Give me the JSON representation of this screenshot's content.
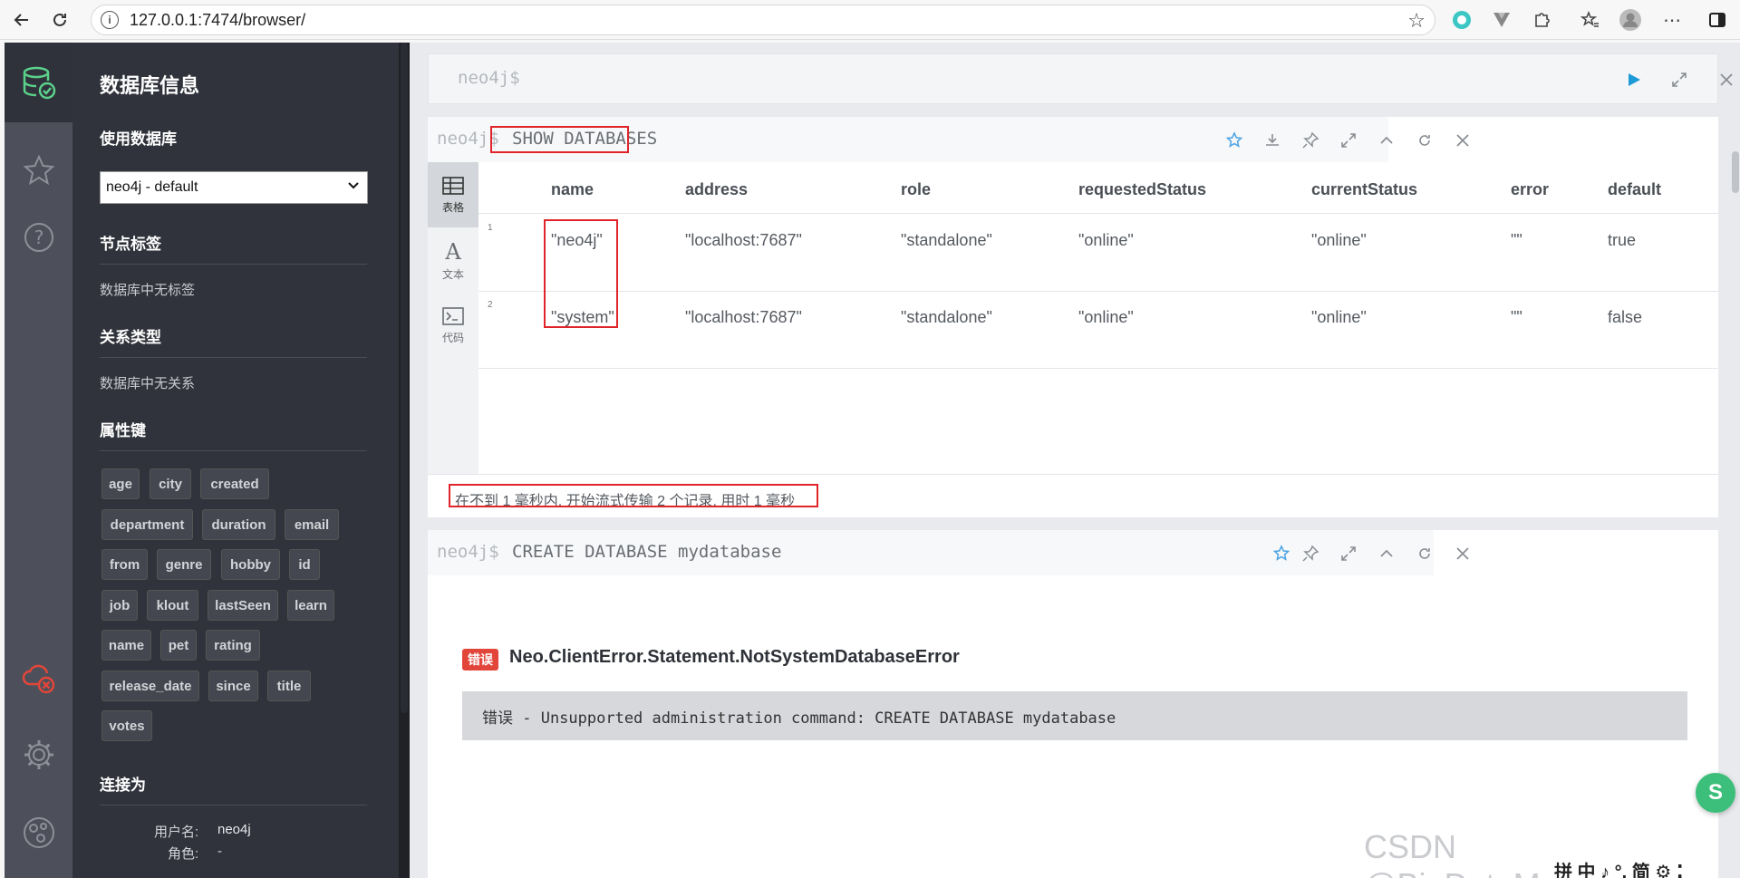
{
  "browser": {
    "url": "127.0.0.1:7474/browser/"
  },
  "drawer": {
    "title": "数据库信息",
    "use_db_heading": "使用数据库",
    "db_select_value": "neo4j - default",
    "node_labels_heading": "节点标签",
    "node_labels_empty": "数据库中无标签",
    "rel_types_heading": "关系类型",
    "rel_types_empty": "数据库中无关系",
    "property_keys_heading": "属性键",
    "property_keys": [
      "age",
      "city",
      "created",
      "department",
      "duration",
      "email",
      "from",
      "genre",
      "hobby",
      "id",
      "job",
      "klout",
      "lastSeen",
      "learn",
      "name",
      "pet",
      "rating",
      "release_date",
      "since",
      "title",
      "votes"
    ],
    "connected_as_heading": "连接为",
    "username_label": "用户名:",
    "username_value": "neo4j",
    "role_label": "角色:",
    "role_value": "-"
  },
  "editor": {
    "prompt": "neo4j$"
  },
  "frame1": {
    "prompt": "neo4j$",
    "command": "SHOW DATABASES",
    "tabs": [
      {
        "label": "表格",
        "icon": "table-icon"
      },
      {
        "label": "文本",
        "icon": "text-icon"
      },
      {
        "label": "代码",
        "icon": "code-icon"
      }
    ],
    "columns": [
      "name",
      "address",
      "role",
      "requestedStatus",
      "currentStatus",
      "error",
      "default"
    ],
    "rows": [
      {
        "num": "1",
        "cells": [
          "\"neo4j\"",
          "\"localhost:7687\"",
          "\"standalone\"",
          "\"online\"",
          "\"online\"",
          "\"\"",
          "true"
        ]
      },
      {
        "num": "2",
        "cells": [
          "\"system\"",
          "\"localhost:7687\"",
          "\"standalone\"",
          "\"online\"",
          "\"online\"",
          "\"\"",
          "false"
        ]
      }
    ],
    "status": "在不到 1 毫秒内, 开始流式传输 2 个记录, 用时 1 毫秒"
  },
  "frame2": {
    "prompt": "neo4j$",
    "command": "CREATE DATABASE mydatabase",
    "error_badge": "错误",
    "error_title": "Neo.ClientError.Statement.NotSystemDatabaseError",
    "error_message": "错误 - Unsupported administration command: CREATE DATABASE mydatabase"
  },
  "overlay": {
    "watermark": "CSDN @BigDataMagician",
    "ime": "拼 中 ♪ °, 简 ⚙ ⁚"
  },
  "colors": {
    "rail": "#4d505a",
    "drawer": "#30333b",
    "accent_green": "#3bbf7a",
    "error_red": "#e2463b",
    "highlight_red": "#e0252a",
    "favorite_blue": "#4ba3e3",
    "run_blue": "#1e9bd7"
  }
}
